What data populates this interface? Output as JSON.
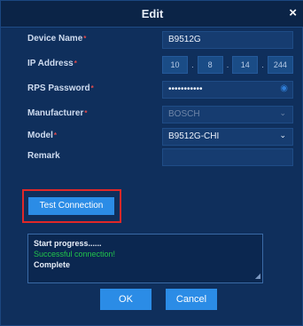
{
  "dialog": {
    "title": "Edit"
  },
  "form": {
    "device_name": {
      "label": "Device Name",
      "value": "B9512G"
    },
    "ip_address": {
      "label": "IP Address",
      "octets": [
        "10",
        "8",
        "14",
        "244"
      ]
    },
    "rps_password": {
      "label": "RPS Password",
      "value": "•••••••••••"
    },
    "manufacturer": {
      "label": "Manufacturer",
      "value": "BOSCH"
    },
    "model": {
      "label": "Model",
      "value": "B9512G-CHI"
    },
    "remark": {
      "label": "Remark",
      "value": ""
    }
  },
  "test_connection": {
    "label": "Test Connection"
  },
  "log": {
    "lines": [
      "Start progress......",
      "Successful connection!",
      "Complete"
    ]
  },
  "buttons": {
    "ok": "OK",
    "cancel": "Cancel"
  },
  "colors": {
    "accent": "#2b8ce6",
    "success": "#21c44a",
    "highlight": "#e02828"
  }
}
